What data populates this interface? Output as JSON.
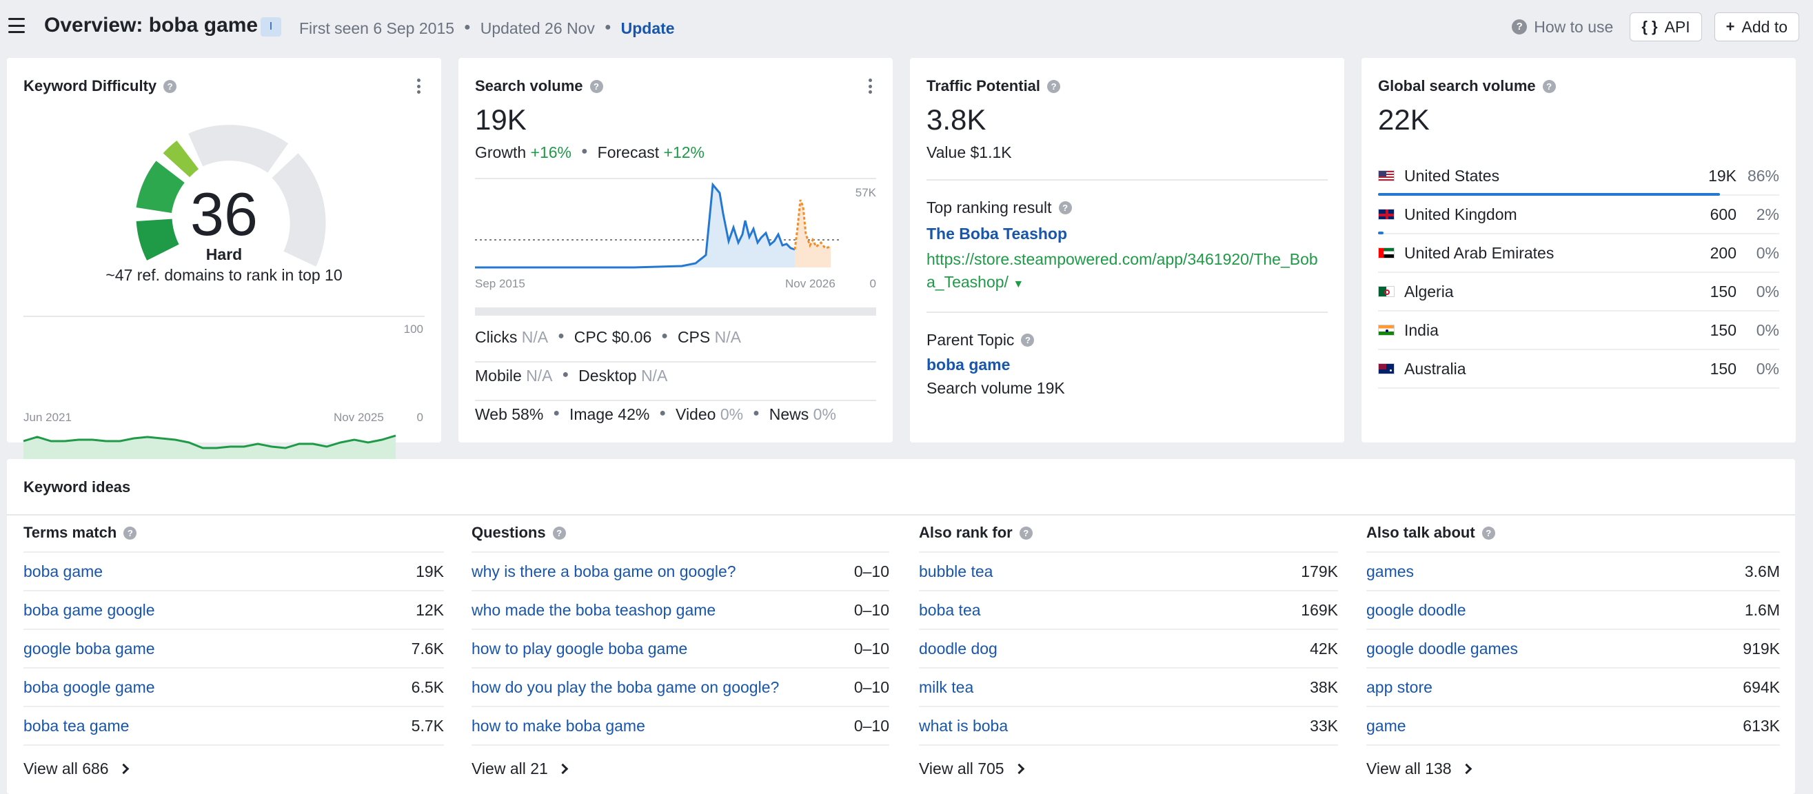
{
  "header": {
    "title": "Overview: boba game",
    "badge": "I",
    "first_seen": "First seen 6 Sep 2015",
    "updated": "Updated 26 Nov",
    "update_link": "Update",
    "how_to_use": "How to use",
    "api_label": "API",
    "add_to_label": "Add to"
  },
  "kd": {
    "title": "Keyword Difficulty",
    "value": "36",
    "label": "Hard",
    "subtitle": "~47 ref. domains to rank in top 10",
    "chart_y_max": "100",
    "chart_y_min": "0",
    "chart_x_start": "Jun 2021",
    "chart_x_end": "Nov 2025"
  },
  "sv": {
    "title": "Search volume",
    "value": "19K",
    "growth_label": "Growth",
    "growth_value": "+16%",
    "forecast_label": "Forecast",
    "forecast_value": "+12%",
    "chart_y_max": "57K",
    "chart_y_min": "0",
    "chart_x_start": "Sep 2015",
    "chart_x_end": "Nov 2026",
    "clicks_label": "Clicks",
    "clicks_value": "N/A",
    "cpc": "CPC $0.06",
    "cps_label": "CPS",
    "cps_value": "N/A",
    "mobile_label": "Mobile",
    "mobile_value": "N/A",
    "desktop_label": "Desktop",
    "desktop_value": "N/A",
    "web": "Web 58%",
    "image": "Image 42%",
    "video_label": "Video",
    "video_value": "0%",
    "news_label": "News",
    "news_value": "0%"
  },
  "tp": {
    "title": "Traffic Potential",
    "value": "3.8K",
    "value_usd": "Value $1.1K",
    "top_ranking_label": "Top ranking result",
    "top_ranking_title": "The Boba Teashop",
    "top_ranking_url": "https://store.steampowered.com/app/3461920/The_Boba_Teashop/",
    "parent_topic_label": "Parent Topic",
    "parent_topic": "boba game",
    "parent_sv": "Search volume 19K"
  },
  "global": {
    "title": "Global search volume",
    "value": "22K",
    "countries": [
      {
        "name": "United States",
        "value": "19K",
        "pct": "86%",
        "flag": "us-flag-icon",
        "share": 0.86
      },
      {
        "name": "United Kingdom",
        "value": "600",
        "pct": "2%",
        "flag": "uk-flag-icon",
        "share": 0.02
      },
      {
        "name": "United Arab Emirates",
        "value": "200",
        "pct": "0%",
        "flag": "uae-flag-icon",
        "share": 0
      },
      {
        "name": "Algeria",
        "value": "150",
        "pct": "0%",
        "flag": "algeria-flag-icon",
        "share": 0
      },
      {
        "name": "India",
        "value": "150",
        "pct": "0%",
        "flag": "india-flag-icon",
        "share": 0
      },
      {
        "name": "Australia",
        "value": "150",
        "pct": "0%",
        "flag": "australia-flag-icon",
        "share": 0
      }
    ]
  },
  "ideas": {
    "title": "Keyword ideas",
    "columns": [
      {
        "title": "Terms match",
        "view_all": "View all 686",
        "rows": [
          [
            "boba game",
            "19K"
          ],
          [
            "boba game google",
            "12K"
          ],
          [
            "google boba game",
            "7.6K"
          ],
          [
            "boba google game",
            "6.5K"
          ],
          [
            "boba tea game",
            "5.7K"
          ]
        ]
      },
      {
        "title": "Questions",
        "view_all": "View all 21",
        "rows": [
          [
            "why is there a boba game on google?",
            "0–10"
          ],
          [
            "who made the boba teashop game",
            "0–10"
          ],
          [
            "how to play google boba game",
            "0–10"
          ],
          [
            "how do you play the boba game on google?",
            "0–10"
          ],
          [
            "how to make boba game",
            "0–10"
          ]
        ]
      },
      {
        "title": "Also rank for",
        "view_all": "View all 705",
        "rows": [
          [
            "bubble tea",
            "179K"
          ],
          [
            "boba tea",
            "169K"
          ],
          [
            "doodle dog",
            "42K"
          ],
          [
            "milk tea",
            "38K"
          ],
          [
            "what is boba",
            "33K"
          ]
        ]
      },
      {
        "title": "Also talk about",
        "view_all": "View all 138",
        "rows": [
          [
            "games",
            "3.6M"
          ],
          [
            "google doodle",
            "1.6M"
          ],
          [
            "google doodle games",
            "919K"
          ],
          [
            "app store",
            "694K"
          ],
          [
            "game",
            "613K"
          ]
        ]
      }
    ]
  },
  "colors": {
    "accent_blue": "#1856ad",
    "positive_green": "#1f9a47",
    "chart_blue": "#2478d2",
    "forecast_orange": "#f28c28",
    "kd_green": "#2ea84f"
  }
}
